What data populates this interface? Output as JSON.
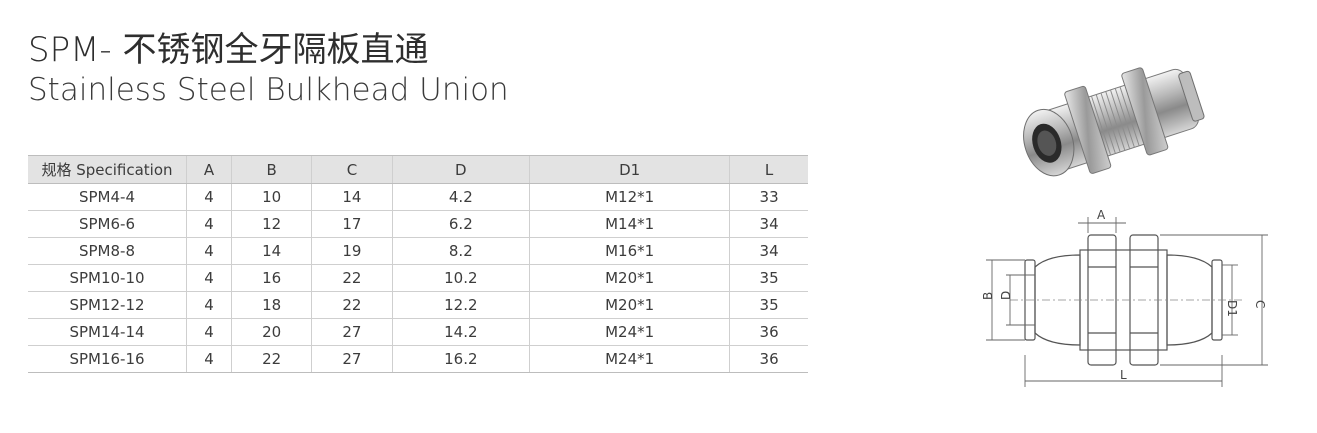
{
  "header": {
    "title_cn": "SPM- 不锈钢全牙隔板直通",
    "title_en": "Stainless Steel Bulkhead Union"
  },
  "table": {
    "columns": [
      "规格 Specification",
      "A",
      "B",
      "C",
      "D",
      "D1",
      "L"
    ],
    "rows": [
      [
        "SPM4-4",
        "4",
        "10",
        "14",
        "4.2",
        "M12*1",
        "33"
      ],
      [
        "SPM6-6",
        "4",
        "12",
        "17",
        "6.2",
        "M14*1",
        "34"
      ],
      [
        "SPM8-8",
        "4",
        "14",
        "19",
        "8.2",
        "M16*1",
        "34"
      ],
      [
        "SPM10-10",
        "4",
        "16",
        "22",
        "10.2",
        "M20*1",
        "35"
      ],
      [
        "SPM12-12",
        "4",
        "18",
        "22",
        "12.2",
        "M20*1",
        "35"
      ],
      [
        "SPM14-14",
        "4",
        "20",
        "27",
        "14.2",
        "M24*1",
        "36"
      ],
      [
        "SPM16-16",
        "4",
        "22",
        "27",
        "16.2",
        "M24*1",
        "36"
      ]
    ]
  },
  "drawing": {
    "labels": {
      "a": "A",
      "b": "B",
      "c": "C",
      "d": "D",
      "d1": "D1",
      "l": "L"
    }
  }
}
